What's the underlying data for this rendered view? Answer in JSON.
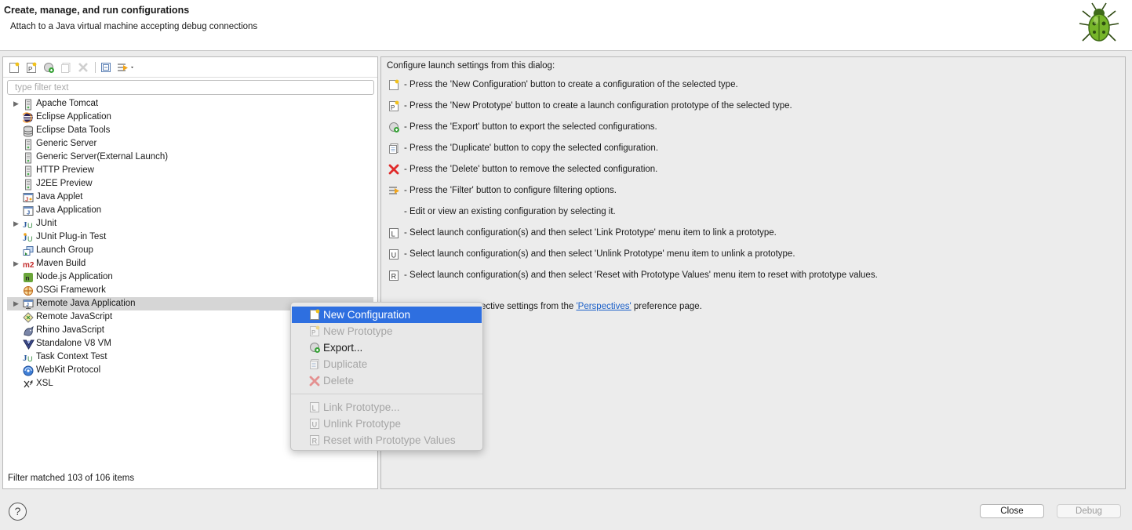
{
  "header": {
    "title": "Create, manage, and run configurations",
    "subtitle": "Attach to a Java virtual machine accepting debug connections",
    "logo_icon": "debug-bug-icon"
  },
  "toolbar": {
    "buttons": [
      {
        "name": "new-configuration-icon",
        "enabled": true
      },
      {
        "name": "new-prototype-icon",
        "enabled": true
      },
      {
        "name": "export-icon",
        "enabled": true
      },
      {
        "name": "duplicate-icon",
        "enabled": false
      },
      {
        "name": "delete-icon",
        "enabled": false
      },
      {
        "name": "collapse-all-icon",
        "enabled": true
      },
      {
        "name": "filter-icon",
        "enabled": true
      }
    ]
  },
  "filter": {
    "placeholder": "type filter text",
    "value": ""
  },
  "tree": {
    "items": [
      {
        "label": "Apache Tomcat",
        "expandable": true,
        "icon": "server-icon"
      },
      {
        "label": "Eclipse Application",
        "expandable": false,
        "icon": "eclipse-icon"
      },
      {
        "label": "Eclipse Data Tools",
        "expandable": false,
        "icon": "database-icon"
      },
      {
        "label": "Generic Server",
        "expandable": false,
        "icon": "server-icon"
      },
      {
        "label": "Generic Server(External Launch)",
        "expandable": false,
        "icon": "server-icon"
      },
      {
        "label": "HTTP Preview",
        "expandable": false,
        "icon": "server-icon"
      },
      {
        "label": "J2EE Preview",
        "expandable": false,
        "icon": "server-icon"
      },
      {
        "label": "Java Applet",
        "expandable": false,
        "icon": "java-applet-icon"
      },
      {
        "label": "Java Application",
        "expandable": false,
        "icon": "java-application-icon"
      },
      {
        "label": "JUnit",
        "expandable": true,
        "icon": "junit-icon"
      },
      {
        "label": "JUnit Plug-in Test",
        "expandable": false,
        "icon": "junit-plugin-icon"
      },
      {
        "label": "Launch Group",
        "expandable": false,
        "icon": "launch-group-icon"
      },
      {
        "label": "Maven Build",
        "expandable": true,
        "icon": "maven-icon"
      },
      {
        "label": "Node.js Application",
        "expandable": false,
        "icon": "nodejs-icon"
      },
      {
        "label": "OSGi Framework",
        "expandable": false,
        "icon": "osgi-icon"
      },
      {
        "label": "Remote Java Application",
        "expandable": true,
        "icon": "remote-java-icon",
        "selected": true
      },
      {
        "label": "Remote JavaScript",
        "expandable": false,
        "icon": "remote-javascript-icon"
      },
      {
        "label": "Rhino JavaScript",
        "expandable": false,
        "icon": "rhino-icon"
      },
      {
        "label": "Standalone V8 VM",
        "expandable": false,
        "icon": "v8-icon"
      },
      {
        "label": "Task Context Test",
        "expandable": false,
        "icon": "junit-icon"
      },
      {
        "label": "WebKit Protocol",
        "expandable": false,
        "icon": "webkit-icon"
      },
      {
        "label": "XSL",
        "expandable": false,
        "icon": "xsl-icon"
      }
    ]
  },
  "status": "Filter matched 103 of 106 items",
  "right": {
    "intro": "Configure launch settings from this dialog:",
    "hints": [
      {
        "icon": "new-configuration-icon",
        "text": "- Press the 'New Configuration' button to create a configuration of the selected type."
      },
      {
        "icon": "new-prototype-icon",
        "text": "- Press the 'New Prototype' button to create a launch configuration prototype of the selected type."
      },
      {
        "icon": "export-icon",
        "text": "- Press the 'Export' button to export the selected configurations."
      },
      {
        "icon": "duplicate-icon",
        "text": "- Press the 'Duplicate' button to copy the selected configuration."
      },
      {
        "icon": "delete-icon",
        "text": "- Press the 'Delete' button to remove the selected configuration."
      },
      {
        "icon": "filter-icon",
        "text": "- Press the 'Filter' button to configure filtering options."
      },
      {
        "icon": "",
        "text": "- Edit or view an existing configuration by selecting it."
      },
      {
        "icon": "link-prototype-icon",
        "text": "- Select launch configuration(s) and then select 'Link Prototype' menu item to link a prototype."
      },
      {
        "icon": "unlink-prototype-icon",
        "text": "- Select launch configuration(s) and then select 'Unlink Prototype' menu item to unlink a prototype."
      },
      {
        "icon": "reset-prototype-icon",
        "text": "- Select launch configuration(s) and then select 'Reset with Prototype Values' menu item to reset with prototype values."
      }
    ],
    "perspectives_prefix": "ective settings from the ",
    "perspectives_link": "'Perspectives'",
    "perspectives_suffix": " preference page."
  },
  "context_menu": {
    "items": [
      {
        "label": "New Configuration",
        "icon": "new-configuration-icon",
        "state": "active"
      },
      {
        "label": "New Prototype",
        "icon": "new-prototype-icon",
        "state": "disabled"
      },
      {
        "label": "Export...",
        "icon": "export-icon",
        "state": "enabled"
      },
      {
        "label": "Duplicate",
        "icon": "duplicate-icon",
        "state": "disabled"
      },
      {
        "label": "Delete",
        "icon": "delete-icon",
        "state": "disabled"
      },
      {
        "label": "Link Prototype...",
        "icon": "link-prototype-icon",
        "state": "disabled"
      },
      {
        "label": "Unlink Prototype",
        "icon": "unlink-prototype-icon",
        "state": "disabled"
      },
      {
        "label": "Reset with Prototype Values",
        "icon": "reset-prototype-icon",
        "state": "disabled"
      }
    ]
  },
  "buttons": {
    "help": "?",
    "close": "Close",
    "debug": "Debug"
  }
}
